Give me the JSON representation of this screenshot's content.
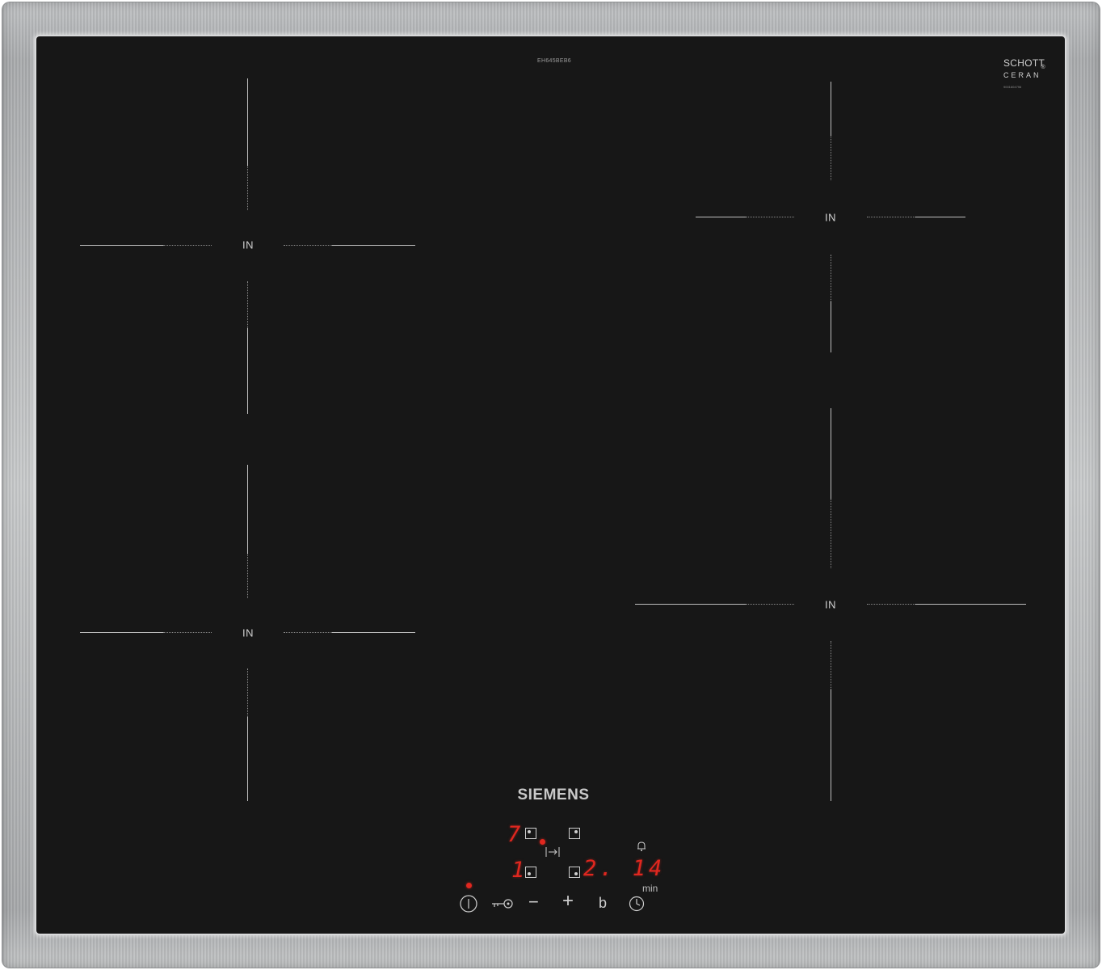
{
  "hob": {
    "model": "EH645BEB6",
    "glass_brand_line1": "SCHOTT",
    "glass_brand_line2": "CERAN",
    "glass_serial": "9001604796",
    "brand": "SIEMENS"
  },
  "zones": [
    {
      "id": "front-left",
      "label": "IN"
    },
    {
      "id": "rear-left",
      "label": "IN"
    },
    {
      "id": "rear-right",
      "label": "IN"
    },
    {
      "id": "front-right",
      "label": "IN"
    }
  ],
  "display": {
    "rear_left_level": "7",
    "front_left_level": "1",
    "timer_value": "2. 14",
    "timer_unit": "min"
  },
  "controls": {
    "power": "power-icon",
    "lock": "childlock-key-icon",
    "minus": "−",
    "plus": "+",
    "boost": "b",
    "timer": "timer-clock-icon",
    "alarm": "bell-icon",
    "move": "transfer-icon"
  },
  "colors": {
    "glass": "#171717",
    "frame": "#b5b7b9",
    "led_red": "#e0271f",
    "print": "#cfcfcf"
  }
}
